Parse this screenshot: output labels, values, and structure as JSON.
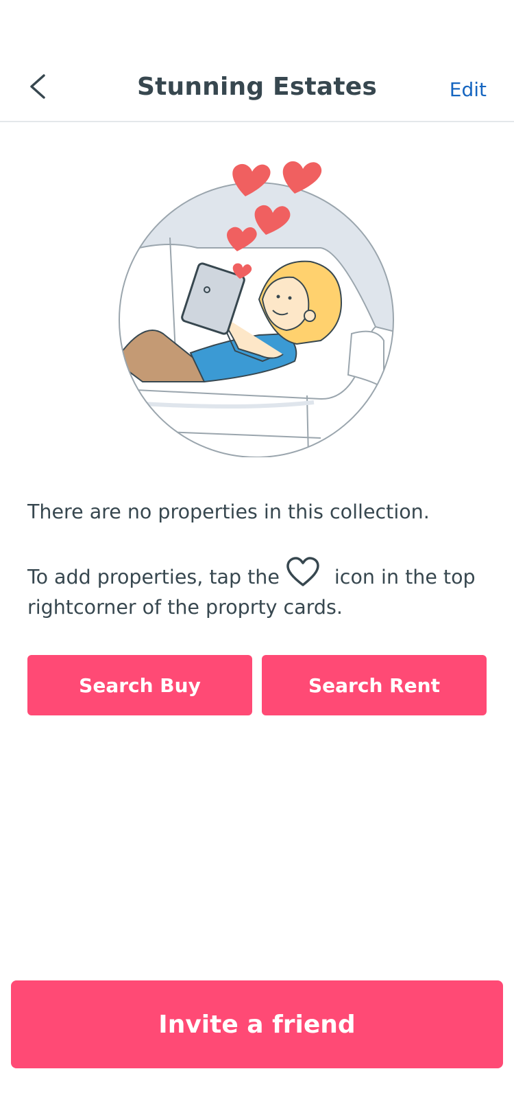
{
  "header": {
    "back_icon": "chevron-left-icon",
    "title": "Stunning Estates",
    "edit_label": "Edit"
  },
  "empty_state": {
    "message": "There are no properties in this collection.",
    "hint_before": "To add properties, tap the",
    "hint_icon": "heart-outline-icon",
    "hint_after": "icon in the top rightcorner of the proprty cards."
  },
  "actions": {
    "search_buy_label": "Search Buy",
    "search_rent_label": "Search Rent",
    "invite_label": "Invite a friend"
  },
  "colors": {
    "accent": "#ff4a75",
    "link": "#1565c0",
    "text": "#37474f"
  }
}
